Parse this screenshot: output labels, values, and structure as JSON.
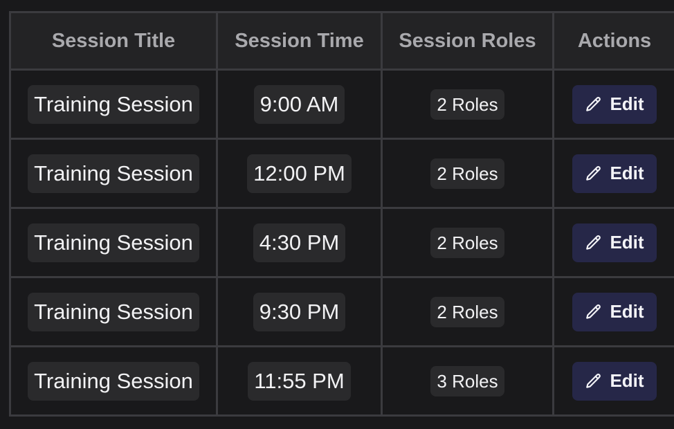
{
  "table": {
    "headers": [
      "Session Title",
      "Session Time",
      "Session Roles",
      "Actions"
    ],
    "rows": [
      {
        "title": "Training Session",
        "time": "9:00 AM",
        "roles": "2 Roles",
        "action": "Edit"
      },
      {
        "title": "Training Session",
        "time": "12:00 PM",
        "roles": "2 Roles",
        "action": "Edit"
      },
      {
        "title": "Training Session",
        "time": "4:30 PM",
        "roles": "2 Roles",
        "action": "Edit"
      },
      {
        "title": "Training Session",
        "time": "9:30 PM",
        "roles": "2 Roles",
        "action": "Edit"
      },
      {
        "title": "Training Session",
        "time": "11:55 PM",
        "roles": "3 Roles",
        "action": "Edit"
      }
    ]
  },
  "icons": {
    "edit": "pencil-icon"
  },
  "colors": {
    "background": "#19191b",
    "header_bg": "#232325",
    "border": "#3b3b3f",
    "pill_bg": "#2a2a2c",
    "button_bg": "#262748"
  }
}
